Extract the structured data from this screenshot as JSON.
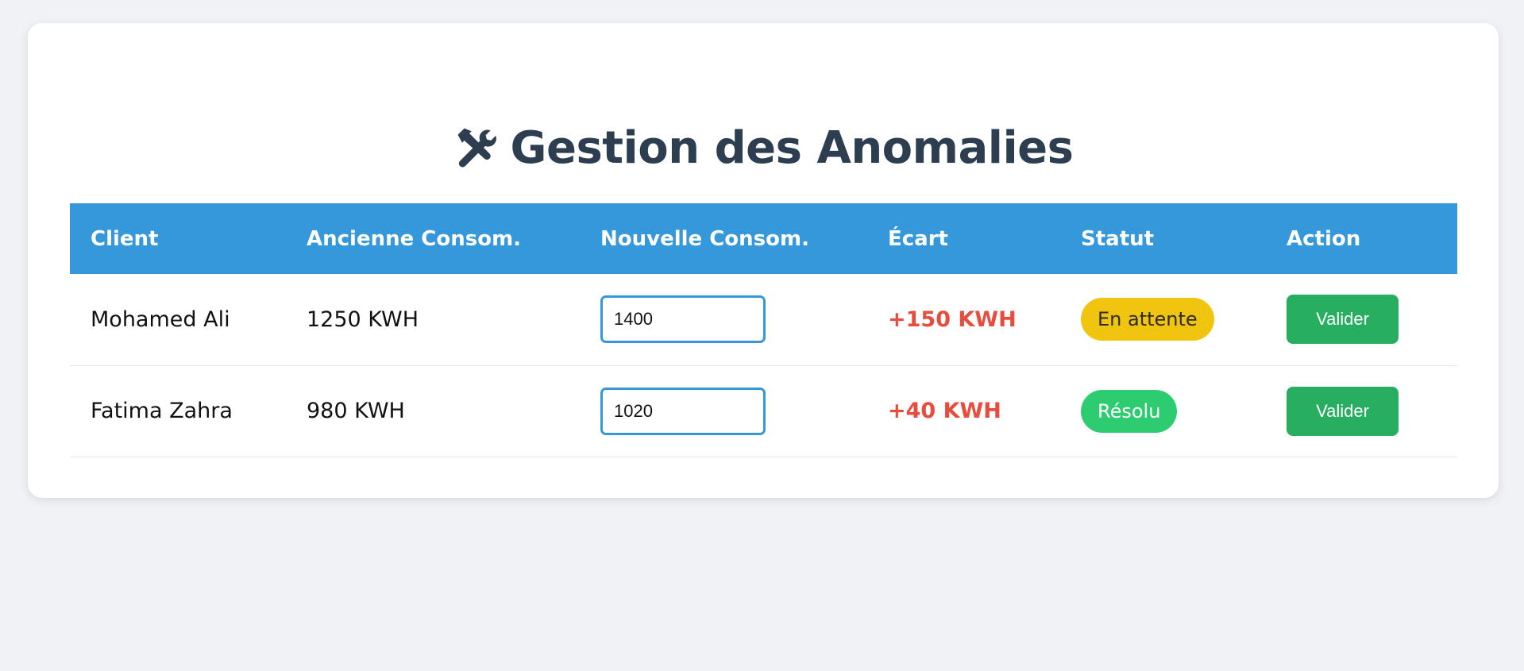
{
  "page": {
    "title": "Gestion des Anomalies",
    "title_icon": "tools-icon"
  },
  "table": {
    "headers": [
      "Client",
      "Ancienne Consom.",
      "Nouvelle Consom.",
      "Écart",
      "Statut",
      "Action"
    ],
    "rows": [
      {
        "client": "Mohamed Ali",
        "ancienne": "1250 KWH",
        "nouvelle": "1400",
        "ecart": "+150 KWH",
        "statut": "En attente",
        "action": "Valider"
      },
      {
        "client": "Fatima Zahra",
        "ancienne": "980 KWH",
        "nouvelle": "1020",
        "ecart": "+40 KWH",
        "statut": "Résolu",
        "action": "Valider"
      }
    ]
  },
  "colors": {
    "header_bg": "#3498db",
    "title": "#2c3e50",
    "ecart": "#e74c3c",
    "badge_pending": "#f1c40f",
    "badge_resolved": "#2ecc71",
    "button": "#27ae60",
    "page_bg": "#f0f2f5"
  }
}
